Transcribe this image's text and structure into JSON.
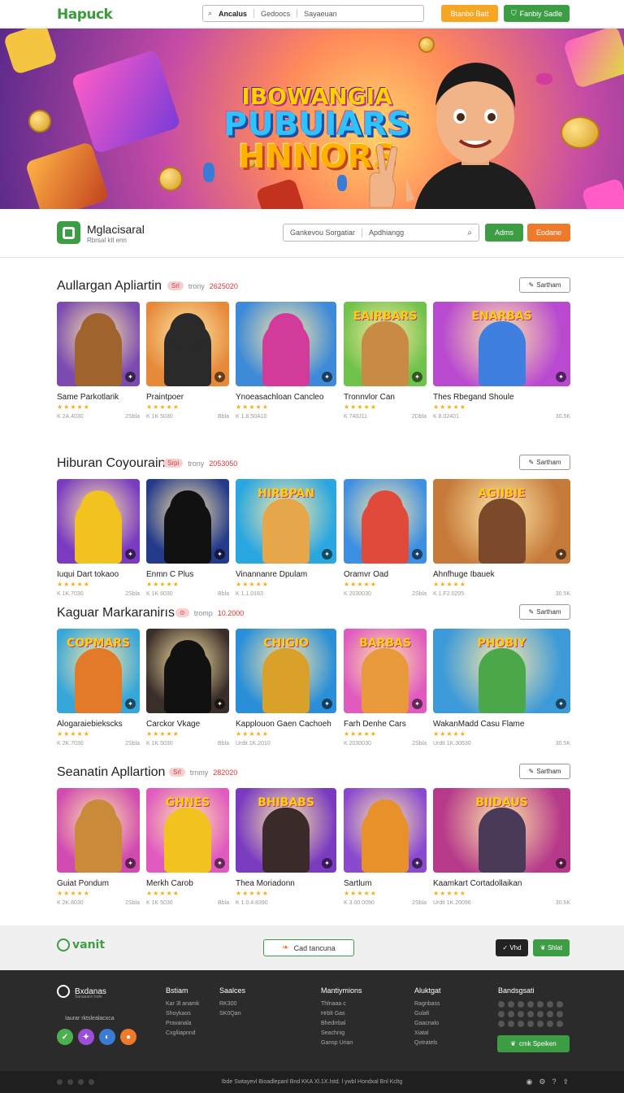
{
  "topbar": {
    "logo": "Hapuck",
    "search": [
      "Ancalus",
      "Gedoocs",
      "Sayaeuan"
    ],
    "btn_orange": "Btanbo Batt",
    "btn_green": "Fanbiy Sadle"
  },
  "hero": {
    "line1": "IBOWANGIA",
    "line2": "PUBUIARS",
    "line3": "HNNORS"
  },
  "subheader": {
    "brand_name": "Mglacisaral",
    "brand_sub": "Rbrsal ktl enn",
    "search": [
      "Gankevou Sorgatiar",
      "Apdhiangg"
    ],
    "btn_green": "Adms",
    "btn_orange": "Eodane"
  },
  "sections": [
    {
      "title": "Aullargan Apliartin",
      "pill": "Srl",
      "meta_label": "trony",
      "meta_value": "2625020",
      "btn": "Sartham",
      "cards": [
        {
          "name": "Same Parkotlarik",
          "info_left": "K 2A.4030",
          "info_right": "2Sbla",
          "bg": "#7b4bb0",
          "fig": "#a0632e",
          "banner": ""
        },
        {
          "name": "Praintpoer",
          "info_left": "K 1K 5030",
          "info_right": "Bbla",
          "bg": "#e68a3a",
          "fig": "#2a2a2a",
          "banner": ""
        },
        {
          "name": "Ynoeasachloan Cancleo",
          "info_left": "K 1.8.50A10",
          "info_right": "",
          "bg": "#3d8ad8",
          "fig": "#d33b9b",
          "banner": ""
        },
        {
          "name": "Tronnvlor Can",
          "info_left": "K 740J11",
          "info_right": "2Dbla",
          "bg": "#6fc24a",
          "fig": "#c98a44",
          "banner": "EAIRBARS"
        },
        {
          "name": "Thes Rbegand Shoule",
          "info_left": "K 8.02401",
          "info_right": "30.5K",
          "bg": "#b94ad0",
          "fig": "#3f7fe0",
          "banner": "ENARBAS"
        }
      ]
    },
    {
      "title": "Hiburan Coyourain",
      "pill": "Srpi",
      "meta_label": "trony",
      "meta_value": "2053050",
      "btn": "Sartham",
      "cards": [
        {
          "name": "Iuqui Dart tokaoo",
          "info_left": "K 1K.7030",
          "info_right": "2Sbla",
          "bg": "#7a3bc0",
          "fig": "#f2c21e",
          "banner": ""
        },
        {
          "name": "Enmn C Plus",
          "info_left": "K 1K 6030",
          "info_right": "Bbla",
          "bg": "#243a8a",
          "fig": "#111111",
          "banner": ""
        },
        {
          "name": "Vinannanre Dpulam",
          "info_left": "K 1.1.0183",
          "info_right": "",
          "bg": "#2aa7e0",
          "fig": "#e6a64a",
          "banner": "HIRBPAN"
        },
        {
          "name": "Oramvr Oad",
          "info_left": "K 2030030",
          "info_right": "2Sbla",
          "bg": "#3c8fe3",
          "fig": "#e04a3a",
          "banner": ""
        },
        {
          "name": "Ahnfhuge Ibauek",
          "info_left": "K 1.F2.0205",
          "info_right": "30.5K",
          "bg": "#c67a3a",
          "fig": "#7a4a2a",
          "banner": "AGIIBIE"
        }
      ]
    },
    {
      "title": "Kaguar Markaranirıs",
      "pill": "",
      "meta_label": "tromp",
      "meta_value": "10.2000",
      "btn": "Sartham",
      "cards": [
        {
          "name": "Alogaraiebiekscks",
          "info_left": "K 2K.7030",
          "info_right": "2Sbla",
          "bg": "#37a6d8",
          "fig": "#e27a2a",
          "banner": "COPMARS"
        },
        {
          "name": "Carckor Vkage",
          "info_left": "K 1K 5030",
          "info_right": "Bbla",
          "bg": "#3a2e2a",
          "fig": "#111111",
          "banner": ""
        },
        {
          "name": "Kapplouon Gaen Cachoeh",
          "info_left": "Urdit 1K.2010",
          "info_right": "",
          "bg": "#2a8fd8",
          "fig": "#d9a02a",
          "banner": "CHIGIO"
        },
        {
          "name": "Farh Denhe Cars",
          "info_left": "K 2030030",
          "info_right": "2Sbla",
          "bg": "#e05abf",
          "fig": "#e89a3a",
          "banner": "BARBAS"
        },
        {
          "name": "WakanMadd Casu Flame",
          "info_left": "Urdit 1K.30530",
          "info_right": "30.5K",
          "bg": "#3d9ad8",
          "fig": "#4aa84a",
          "banner": "PHOBIY"
        }
      ]
    },
    {
      "title": "Seanatin Apllartion",
      "pill": "Srl",
      "meta_label": "trnmy",
      "meta_value": "282020",
      "btn": "Sartham",
      "cards": [
        {
          "name": "Guiat Pondum",
          "info_left": "K 2K.8030",
          "info_right": "2Sbla",
          "bg": "#d04ab0",
          "fig": "#c98a3a",
          "banner": ""
        },
        {
          "name": "Merkh Carob",
          "info_left": "K 1K 5030",
          "info_right": "Bbla",
          "bg": "#e05ac0",
          "fig": "#f2c21e",
          "banner": "GHNES"
        },
        {
          "name": "Thea Moriadonn",
          "info_left": "K 1.0.4.8390",
          "info_right": "",
          "bg": "#7a3bc0",
          "fig": "#3a2a2a",
          "banner": "BHIBABS"
        },
        {
          "name": "Sartlum",
          "info_left": "K 3.00.0090",
          "info_right": "2Sbla",
          "bg": "#8a4ad0",
          "fig": "#e8902a",
          "banner": ""
        },
        {
          "name": "Kaamkart Cortadollaikan",
          "info_left": "Urdit 1K.20096",
          "info_right": "30.5K",
          "bg": "#b73a8a",
          "fig": "#4a3a5a",
          "banner": "BIIDAUS"
        }
      ]
    }
  ],
  "band": {
    "logo": "vanit",
    "btn": "Cad tancuna",
    "dark_btn": "Vhd",
    "green_btn": "Shlat"
  },
  "footer": {
    "brand": "Bxdanas",
    "brand_sub": "Sanaaann kotn",
    "tag": "Iaurar rktslealacxca",
    "cols": [
      {
        "h": "Bstiam",
        "items": [
          "Kar 3l anamk",
          "Shoykaos",
          "Pravanala",
          "Cxgliiapnnd"
        ]
      },
      {
        "h": "Saalces",
        "items": [
          "RK300",
          "",
          "SK0Qan"
        ]
      },
      {
        "h": "Mantiymions",
        "items": [
          "Thlnaaa c",
          "Hrblt Gas",
          "Bhedrrbal",
          "Seachnig",
          "Gansp Urian"
        ]
      },
      {
        "h": "Aluktgat",
        "items": [
          "Ragnbass",
          "Gulafi",
          "Gaacnalo",
          "Xiatal",
          "Qotratels"
        ]
      }
    ],
    "right_h": "Bandsgsati",
    "right_btn": "cmk Speiken",
    "copyright": "Ibde Swtayevl Bioadlepanl Bnd KKA Xl.1X.Istd. l ywbl Hondxal Bnl Kcltg"
  },
  "colors": {
    "brand_green": "#3d9d45",
    "accent_orange": "#f07a2c",
    "accent_yellow": "#f5a623",
    "footer_dark": "#2b2b2b"
  }
}
